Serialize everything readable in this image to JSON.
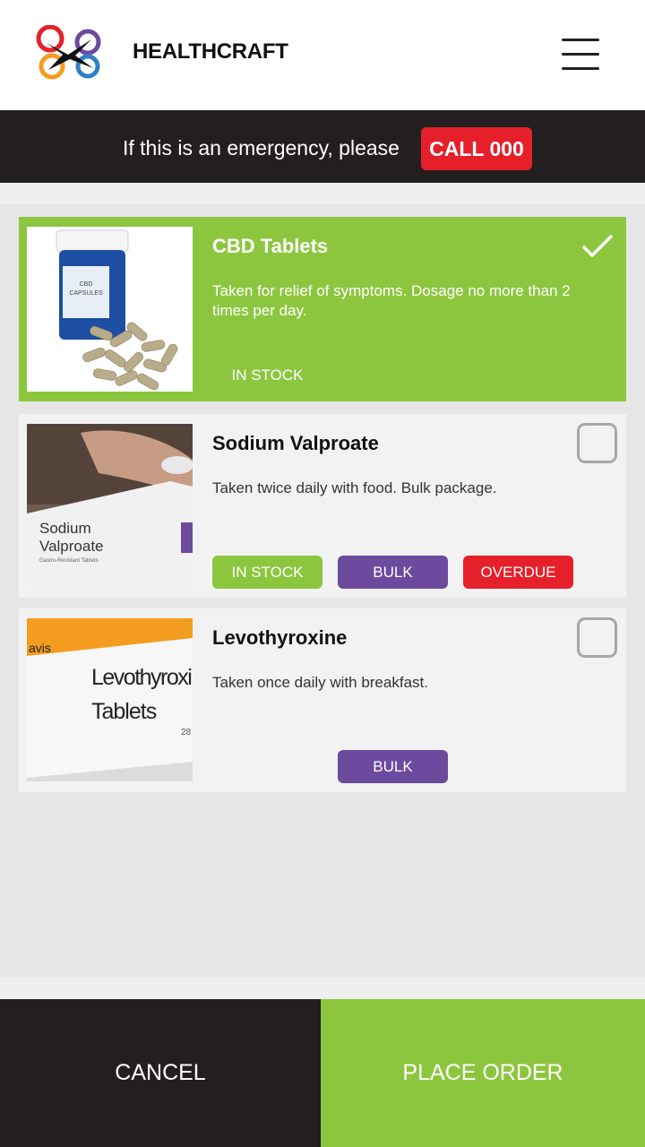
{
  "header": {
    "brand": "HEALTHCRAFT",
    "logo_icon": "healthcraft-logo",
    "menu_icon": "hamburger-menu-icon"
  },
  "emergency": {
    "text": "If this is an emergency, please",
    "call_label": "CALL 000"
  },
  "medications": [
    {
      "name": "CBD Tablets",
      "description": "Taken for relief of symptoms. Dosage no more than 2 times per day.",
      "selected": true,
      "image": "cbd-capsules-bottle",
      "tags": [
        "IN STOCK"
      ]
    },
    {
      "name": "Sodium Valproate",
      "description": "Taken twice daily with food. Bulk package.",
      "selected": false,
      "image": "sodium-valproate-box",
      "image_text": [
        "Sodium",
        "Valproate",
        "Gastro-Resistant Tablets"
      ],
      "tags": [
        "IN STOCK",
        "BULK",
        "OVERDUE"
      ]
    },
    {
      "name": "Levothyroxine",
      "description": "Taken once daily with breakfast.",
      "selected": false,
      "image": "levothyroxine-box",
      "image_text": [
        "avis",
        "Levothyroxine",
        "Tablets",
        "28"
      ],
      "tags": [
        "BULK"
      ]
    }
  ],
  "bottomic": {},
  "footer": {
    "cancel_label": "CANCEL",
    "order_label": "PLACE ORDER"
  },
  "colors": {
    "accent_green": "#8cc63f",
    "dark": "#231f20",
    "emergency_red": "#e5202a",
    "bulk_purple": "#6c4a9e"
  }
}
